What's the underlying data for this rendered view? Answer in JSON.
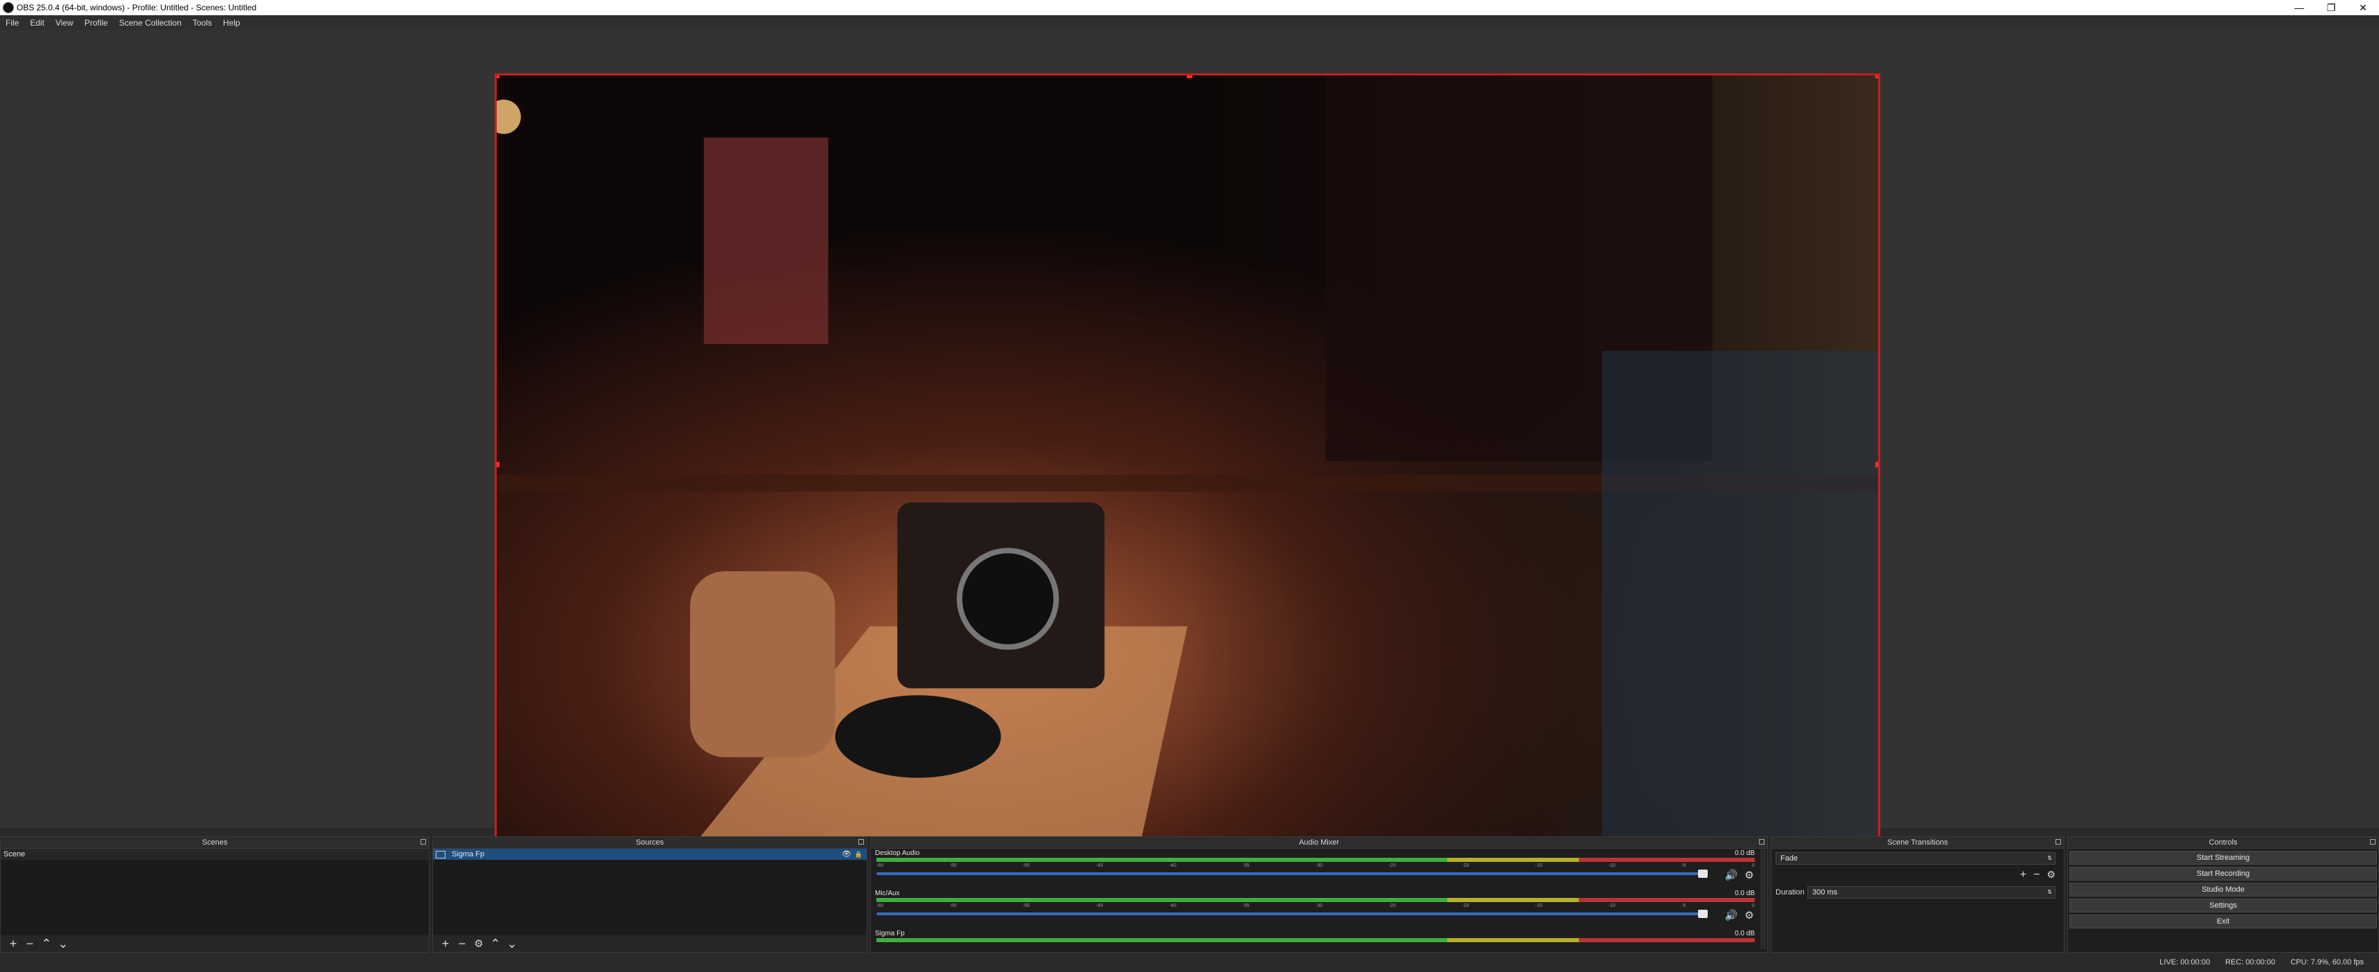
{
  "window": {
    "title": "OBS 25.0.4 (64-bit, windows) - Profile: Untitled - Scenes: Untitled",
    "controls": [
      "—",
      "❐",
      "✕"
    ]
  },
  "menu": [
    "File",
    "Edit",
    "View",
    "Profile",
    "Scene Collection",
    "Tools",
    "Help"
  ],
  "scenes": {
    "title": "Scenes",
    "items": [
      "Scene"
    ],
    "toolbar_icons": [
      "+",
      "−",
      "⌃",
      "⌄"
    ]
  },
  "sources": {
    "title": "Sources",
    "items": [
      {
        "label": "Sigma Fp",
        "visible_icon": "eye-icon",
        "lock_icon": "lock-icon"
      }
    ],
    "toolbar_icons": [
      "+",
      "−",
      "⚙",
      "⌃",
      "⌄"
    ]
  },
  "audio_mixer": {
    "title": "Audio Mixer",
    "channels": [
      {
        "name": "Desktop Audio",
        "db": "0.0 dB"
      },
      {
        "name": "Mic/Aux",
        "db": "0.0 dB"
      },
      {
        "name": "Sigma Fp",
        "db": "0.0 dB"
      }
    ],
    "tick_labels": [
      "-60",
      "-55",
      "-50",
      "-45",
      "-40",
      "-35",
      "-30",
      "-25",
      "-20",
      "-15",
      "-10",
      "-5",
      "0"
    ]
  },
  "scene_transitions": {
    "title": "Scene Transitions",
    "transition": "Fade",
    "duration_label": "Duration",
    "duration_value": "300 ms"
  },
  "controls": {
    "title": "Controls",
    "buttons": [
      "Start Streaming",
      "Start Recording",
      "Studio Mode",
      "Settings",
      "Exit"
    ]
  },
  "status": {
    "live": "LIVE: 00:00:00",
    "rec": "REC: 00:00:00",
    "cpu": "CPU: 7.9%, 60.00 fps"
  },
  "colors": {
    "selection_border": "#c81e1e",
    "selected_row": "#1f4e80",
    "meter_green": "#3fae3f",
    "meter_yellow": "#b6b02f",
    "meter_red": "#b73434",
    "fader_blue": "#2f6fc3"
  }
}
